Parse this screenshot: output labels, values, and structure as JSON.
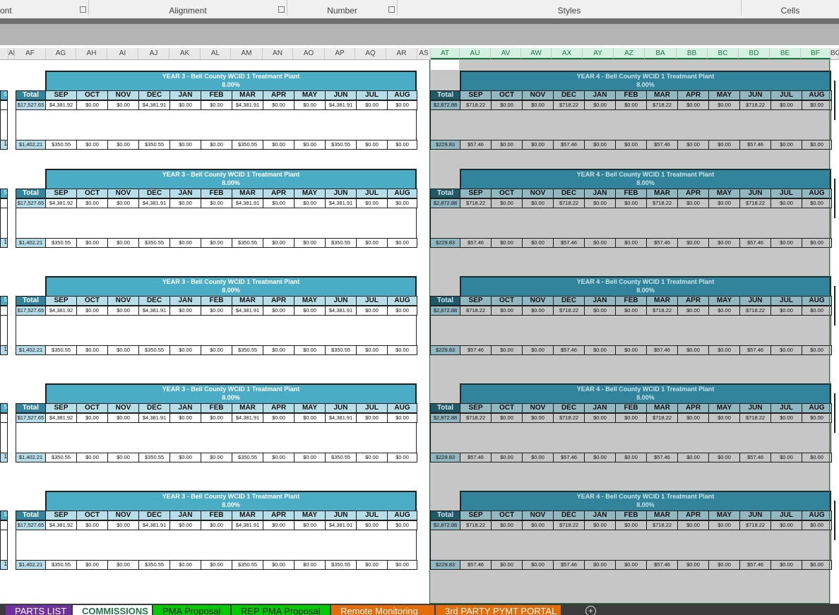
{
  "ribbon": {
    "groups": [
      {
        "label": "ont"
      },
      {
        "label": "Alignment"
      },
      {
        "label": "Number"
      },
      {
        "label": "Styles"
      },
      {
        "label": "Cells"
      }
    ]
  },
  "column_headers": [
    "AE",
    "AF",
    "AG",
    "AH",
    "AI",
    "AJ",
    "AK",
    "AL",
    "AM",
    "AN",
    "AO",
    "AP",
    "AQ",
    "AR",
    "AS",
    "AT",
    "AU",
    "AV",
    "AW",
    "AX",
    "AY",
    "AZ",
    "BA",
    "BB",
    "BC",
    "BD",
    "BE",
    "BF",
    "BG"
  ],
  "selected_columns": [
    "AT",
    "AU",
    "AV",
    "AW",
    "AX",
    "AY",
    "AZ",
    "BA",
    "BB",
    "BC",
    "BD",
    "BE",
    "BF"
  ],
  "months": [
    "SEP",
    "OCT",
    "NOV",
    "DEC",
    "JAN",
    "FEB",
    "MAR",
    "APR",
    "MAY",
    "JUN",
    "JUL",
    "AUG"
  ],
  "total_label": "Total",
  "year3": {
    "title": "YEAR 3 - Bell County WCID 1 Treatmant Plant",
    "rate": "8.00%",
    "total_top": "$17,527.65",
    "row_top": [
      "$4,381.92",
      "$0.00",
      "$0.00",
      "$4,381.91",
      "$0.00",
      "$0.00",
      "$4,381.91",
      "$0.00",
      "$0.00",
      "$4,381.91",
      "$0.00",
      "$0.00"
    ],
    "total_bottom": "$1,402.21",
    "row_bottom": [
      "$350.55",
      "$0.00",
      "$0.00",
      "$350.55",
      "$0.00",
      "$0.00",
      "$350.55",
      "$0.00",
      "$0.00",
      "$350.55",
      "$0.00",
      "$0.00"
    ]
  },
  "year4": {
    "title": "YEAR 4 - Bell County WCID 1 Treatmant Plant",
    "rate": "8.00%",
    "total_top": "$2,872.88",
    "row_top": [
      "$718.22",
      "$0.00",
      "$0.00",
      "$718.22",
      "$0.00",
      "$0.00",
      "$718.22",
      "$0.00",
      "$0.00",
      "$718.22",
      "$0.00",
      "$0.00"
    ],
    "total_bottom": "$229.83",
    "row_bottom": [
      "$57.46",
      "$0.00",
      "$0.00",
      "$57.46",
      "$0.00",
      "$0.00",
      "$57.46",
      "$0.00",
      "$0.00",
      "$57.46",
      "$0.00",
      "$0.00"
    ]
  },
  "left_partial": {
    "top": "5",
    "bottom": "1"
  },
  "sheet_tabs": [
    {
      "label": "PARTS LIST",
      "color": "#7030a0",
      "active": false
    },
    {
      "label": "COMMISSIONS",
      "color": "#ffffff",
      "active": true
    },
    {
      "label": "PMA Proposal",
      "color": "#00cc00",
      "active": false
    },
    {
      "label": "REP PMA Proposal",
      "color": "#00cc00",
      "active": false
    },
    {
      "label": "Remote Monitoring",
      "color": "#e46c0a",
      "active": false
    },
    {
      "label": "3rd PARTY PYMT PORTAL",
      "color": "#e46c0a",
      "active": false
    }
  ],
  "add_sheet_icon": "plus-circle-icon",
  "colors": {
    "header_teal": "#4bacc6",
    "header_light": "#b7dee8",
    "selection_green": "#217346"
  }
}
